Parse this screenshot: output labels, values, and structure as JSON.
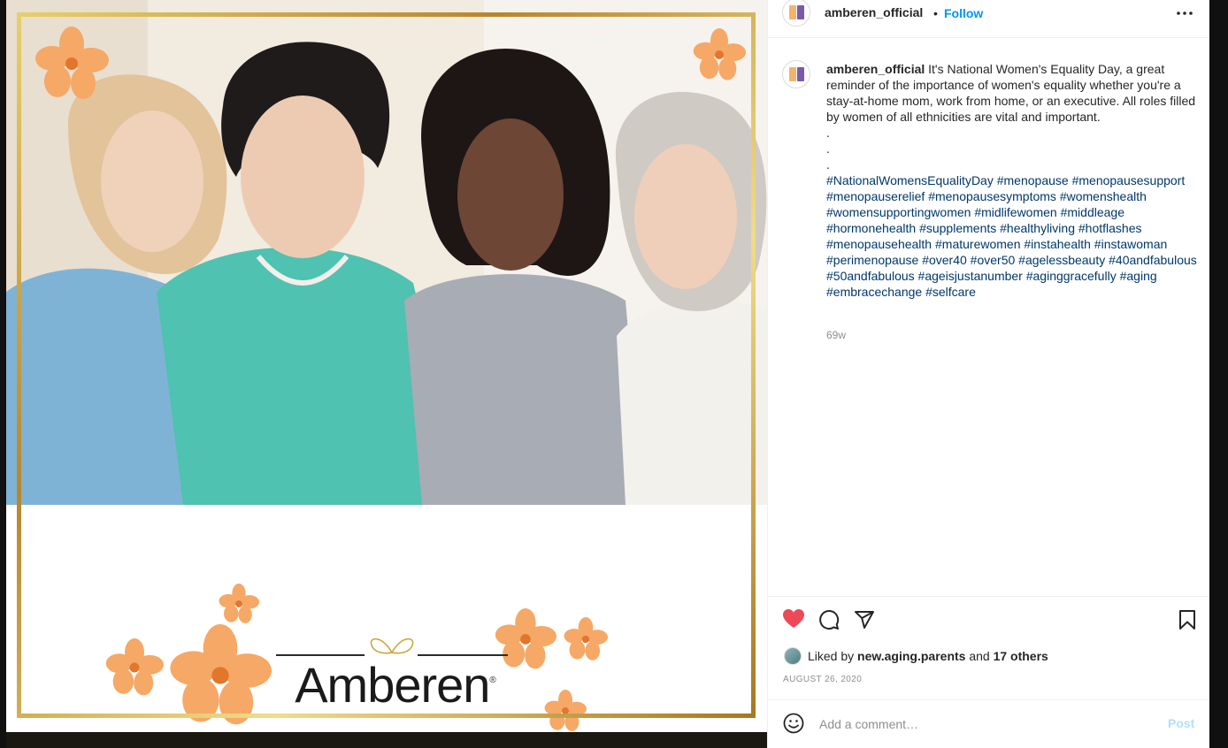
{
  "post": {
    "username": "amberen_official",
    "follow_label": "Follow",
    "dot": "•",
    "caption_text": "It's National Women's Equality Day, a great reminder of the importance of women's equality whether you're a stay-at-home mom, work from home, or an executive. All roles filled by women of all ethnicities are vital and important.",
    "caption_dots": [
      ".",
      ".",
      "."
    ],
    "hashtags": [
      "#NationalWomensEqualityDay",
      "#menopause",
      "#menopausesupport",
      "#menopauserelief",
      "#menopausesymptoms",
      "#womenshealth",
      "#womensupportingwomen",
      "#midlifewomen",
      "#middleage",
      "#hormonehealth",
      "#supplements",
      "#healthyliving",
      "#hotflashes",
      "#menopausehealth",
      "#maturewomen",
      "#instahealth",
      "#instawoman",
      "#perimenopause",
      "#over40",
      "#over50",
      "#agelessbeauty",
      "#40andfabulous",
      "#50andfabulous",
      "#ageisjustanumber",
      "#aginggracefully",
      "#aging",
      "#embracechange",
      "#selfcare"
    ],
    "time_ago": "69w",
    "liked_by_prefix": "Liked by",
    "liked_by_user": "new.aging.parents",
    "liked_by_and": "and",
    "liked_by_others": "17 others",
    "date": "AUGUST 26, 2020",
    "comment_placeholder": "Add a comment…",
    "post_label": "Post"
  },
  "image": {
    "brand_name": "Amberen",
    "brand_mark": "®"
  },
  "icons": {
    "more": "more-options-icon",
    "like": "heart-icon",
    "comment": "comment-icon",
    "share": "share-icon",
    "save": "bookmark-icon",
    "emoji": "emoji-icon"
  },
  "colors": {
    "like_active": "#ed4956",
    "link": "#0095f6",
    "hashtag": "#00376b",
    "frame_gold": "#c9a33a",
    "flower": "#f6a866"
  }
}
